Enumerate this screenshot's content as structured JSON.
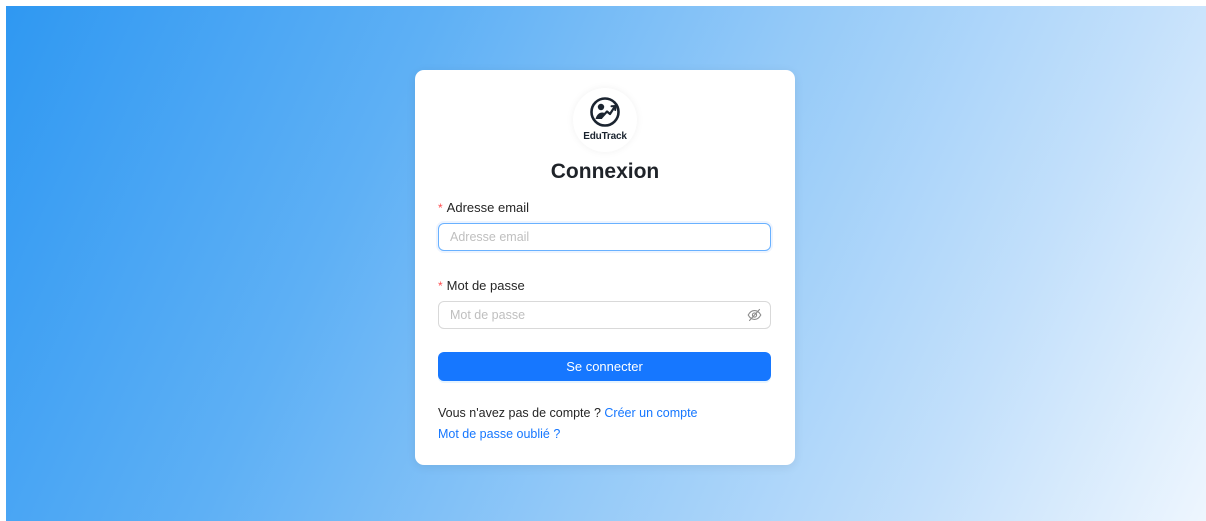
{
  "app": {
    "name": "EduTrack"
  },
  "login": {
    "title": "Connexion",
    "email": {
      "label": "Adresse email",
      "placeholder": "Adresse email",
      "value": ""
    },
    "password": {
      "label": "Mot de passe",
      "placeholder": "Mot de passe",
      "value": "",
      "toggle_icon": "eye-invisible-icon"
    },
    "submit_label": "Se connecter",
    "no_account_text": "Vous n'avez pas de compte ?",
    "create_account_link": "Créer un compte",
    "forgot_password_link": "Mot de passe oublié ?"
  },
  "colors": {
    "primary": "#1677ff",
    "required": "#ff4d4f",
    "focus_border": "#69b1ff"
  }
}
